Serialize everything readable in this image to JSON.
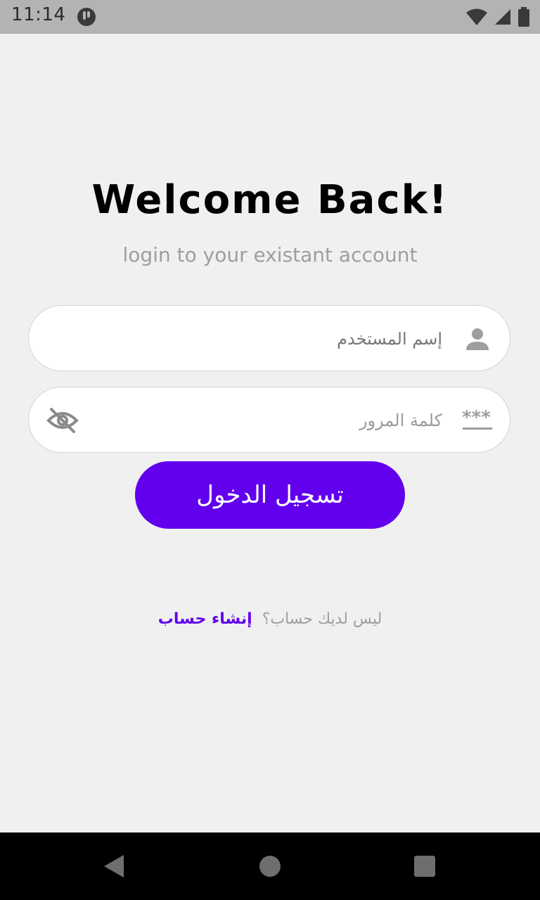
{
  "status_bar": {
    "time": "11:14",
    "icons": [
      "app-notification-icon",
      "wifi-icon",
      "signal-icon",
      "battery-icon"
    ]
  },
  "login": {
    "title": "Welcome Back!",
    "subtitle": "login to your existant account",
    "username": {
      "value": "",
      "placeholder": "إسم المستخدم",
      "icon": "person-icon"
    },
    "password": {
      "value": "",
      "placeholder": "كلمة المرور",
      "icon": "password-icon",
      "toggle_icon": "eye-off-icon"
    },
    "submit_label": "تسجيل الدخول",
    "signup_question": "ليس لديك حساب؟",
    "signup_link": "إنشاء حساب"
  },
  "nav_bar": {
    "buttons": [
      "back",
      "home",
      "recents"
    ]
  },
  "colors": {
    "accent": "#6200ee",
    "background": "#f0f0f0",
    "status_bar": "#b3b3b3",
    "muted_text": "#9e9e9e"
  }
}
